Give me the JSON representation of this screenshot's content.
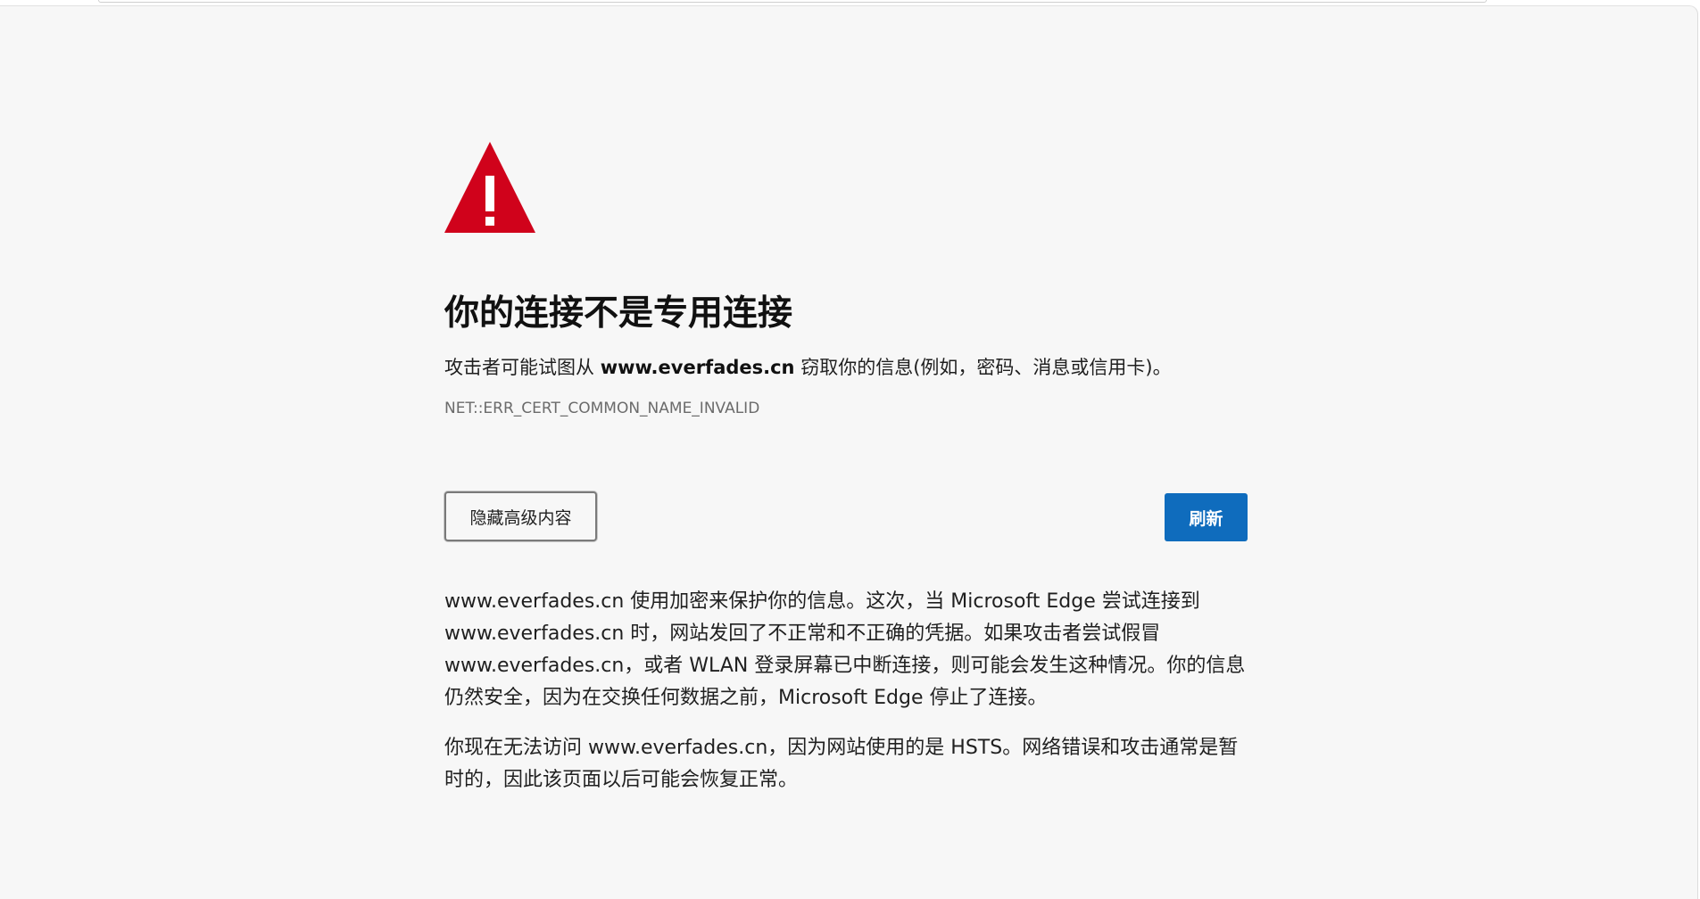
{
  "icons": {
    "warning": "warning-triangle-icon",
    "warning_color": "#d0021b"
  },
  "colors": {
    "page_background": "#f7f7f7",
    "primary_button": "#0f6cbd",
    "error_code_text": "#6b6b6b"
  },
  "error": {
    "title": "你的连接不是专用连接",
    "summary_prefix": "攻击者可能试图从 ",
    "site": "www.everfades.cn",
    "summary_suffix": " 窃取你的信息(例如，密码、消息或信用卡)。",
    "code": "NET::ERR_CERT_COMMON_NAME_INVALID"
  },
  "buttons": {
    "hide_advanced_label": "隐藏高级内容",
    "refresh_label": "刷新"
  },
  "advanced": {
    "paragraph_1": "www.everfades.cn 使用加密来保护你的信息。这次，当 Microsoft Edge 尝试连接到 www.everfades.cn 时，网站发回了不正常和不正确的凭据。如果攻击者尝试假冒 www.everfades.cn，或者 WLAN 登录屏幕已中断连接，则可能会发生这种情况。你的信息仍然安全，因为在交换任何数据之前，Microsoft Edge 停止了连接。",
    "paragraph_2": "你现在无法访问 www.everfades.cn，因为网站使用的是 HSTS。网络错误和攻击通常是暂时的，因此该页面以后可能会恢复正常。"
  }
}
